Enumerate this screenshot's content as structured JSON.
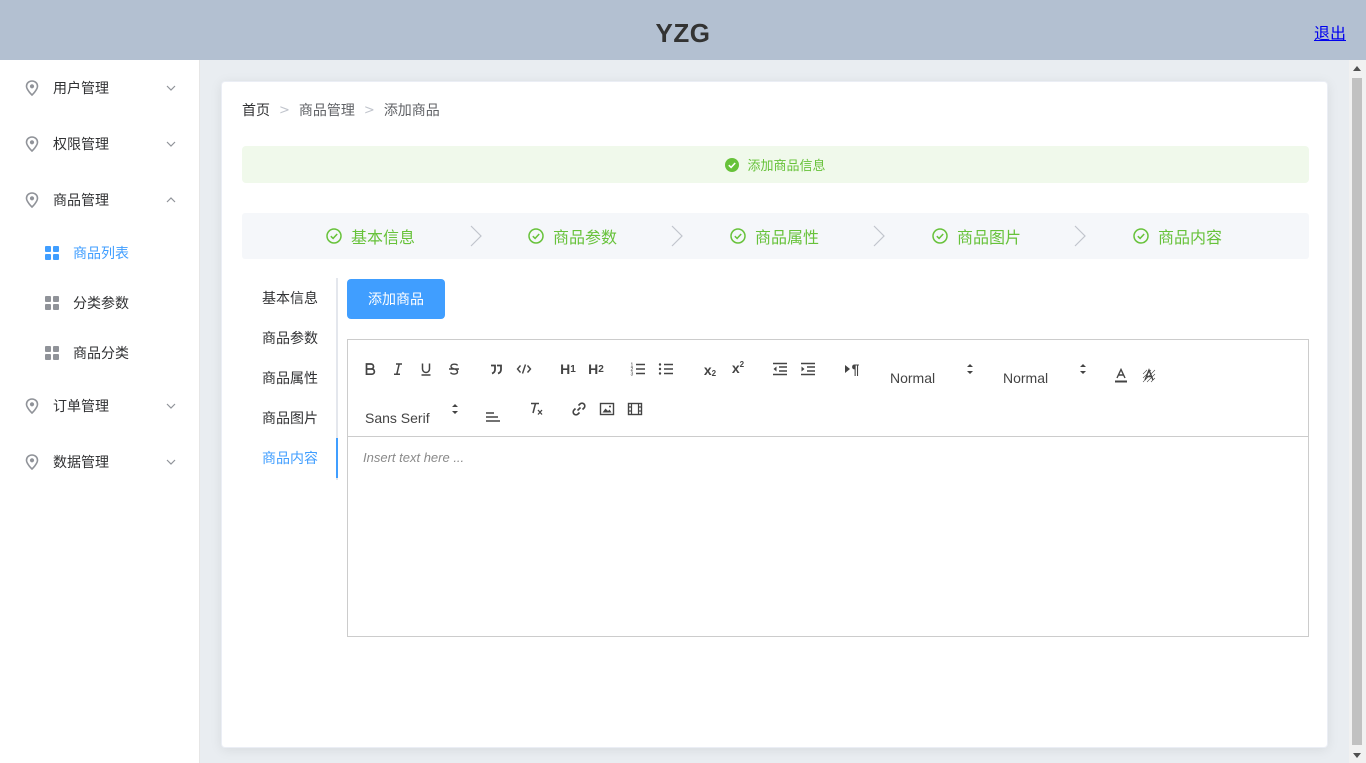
{
  "header": {
    "title": "YZG",
    "logout": "退出"
  },
  "sidebar": {
    "items": [
      {
        "label": "用户管理",
        "expanded": false
      },
      {
        "label": "权限管理",
        "expanded": false
      },
      {
        "label": "商品管理",
        "expanded": true,
        "children": [
          {
            "label": "商品列表",
            "active": true
          },
          {
            "label": "分类参数",
            "active": false
          },
          {
            "label": "商品分类",
            "active": false
          }
        ]
      },
      {
        "label": "订单管理",
        "expanded": false
      },
      {
        "label": "数据管理",
        "expanded": false
      }
    ]
  },
  "breadcrumb": [
    "首页",
    "商品管理",
    "添加商品"
  ],
  "alert": {
    "text": "添加商品信息"
  },
  "steps": [
    "基本信息",
    "商品参数",
    "商品属性",
    "商品图片",
    "商品内容"
  ],
  "tabs": {
    "items": [
      "基本信息",
      "商品参数",
      "商品属性",
      "商品图片",
      "商品内容"
    ],
    "active": "商品内容"
  },
  "add_button": "添加商品",
  "editor": {
    "size_picker": "Normal",
    "header_picker": "Normal",
    "font_picker": "Sans Serif",
    "placeholder": "Insert text here ..."
  },
  "colors": {
    "header_bg": "#b3c0d1",
    "primary": "#409eff",
    "success": "#67c23a",
    "alert_bg": "#f0f9eb"
  }
}
